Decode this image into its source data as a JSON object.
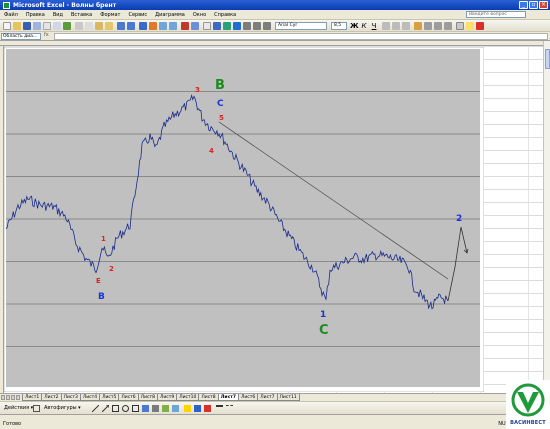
{
  "window": {
    "title": "Microsoft Excel - Волны брент",
    "buttons": [
      "_",
      "▫",
      "×"
    ]
  },
  "menu": {
    "items": [
      "Файл",
      "Правка",
      "Вид",
      "Вставка",
      "Формат",
      "Сервис",
      "Диаграмма",
      "Окно",
      "Справка"
    ],
    "ask_placeholder": "Введите вопрос"
  },
  "toolbar": {
    "font_name": "Arial Cyr",
    "font_size": "8,5"
  },
  "formula_bar": {
    "name_box": "Область диа...",
    "fx": "fx"
  },
  "sheet_tabs": {
    "tabs": [
      "Лист1",
      "Лист2",
      "Лист3",
      "Лист4",
      "Лист5",
      "Лист6",
      "Лист8",
      "Лист9",
      "Лист10",
      "Лист8",
      "Лист7",
      "Лист6",
      "Лист7",
      "Лист11"
    ],
    "active_index": 10
  },
  "draw_toolbar": {
    "actions_label": "Действия ▾",
    "autoshapes_label": "Автофигуры ▾"
  },
  "status": {
    "ready": "Готово",
    "num": "NUM"
  },
  "logo": {
    "brand": "ВАСИНВЕСТ"
  },
  "colors": {
    "plot_bg": "#c0c0c0",
    "wave_label_red": "#e02020",
    "wave_label_blue": "#1a33d9",
    "wave_label_green": "#1f8a1f",
    "projection_blue": "#1f5fd0",
    "logo_green": "#1e9a3a"
  },
  "chart_data": {
    "type": "line",
    "title": "",
    "xlabel": "",
    "ylabel": "",
    "grid": true,
    "legend": "none",
    "annotations": {
      "wave_labels": [
        {
          "text": "1",
          "color": "red"
        },
        {
          "text": "2",
          "color": "red"
        },
        {
          "text": "E",
          "color": "red"
        },
        {
          "text": "B",
          "color": "blue"
        },
        {
          "text": "3",
          "color": "red"
        },
        {
          "text": "4",
          "color": "red"
        },
        {
          "text": "5",
          "color": "red"
        },
        {
          "text": "B",
          "color": "green"
        },
        {
          "text": "C",
          "color": "blue"
        },
        {
          "text": "1",
          "color": "blue"
        },
        {
          "text": "C",
          "color": "green"
        },
        {
          "text": "2",
          "color": "blue"
        }
      ]
    }
  }
}
